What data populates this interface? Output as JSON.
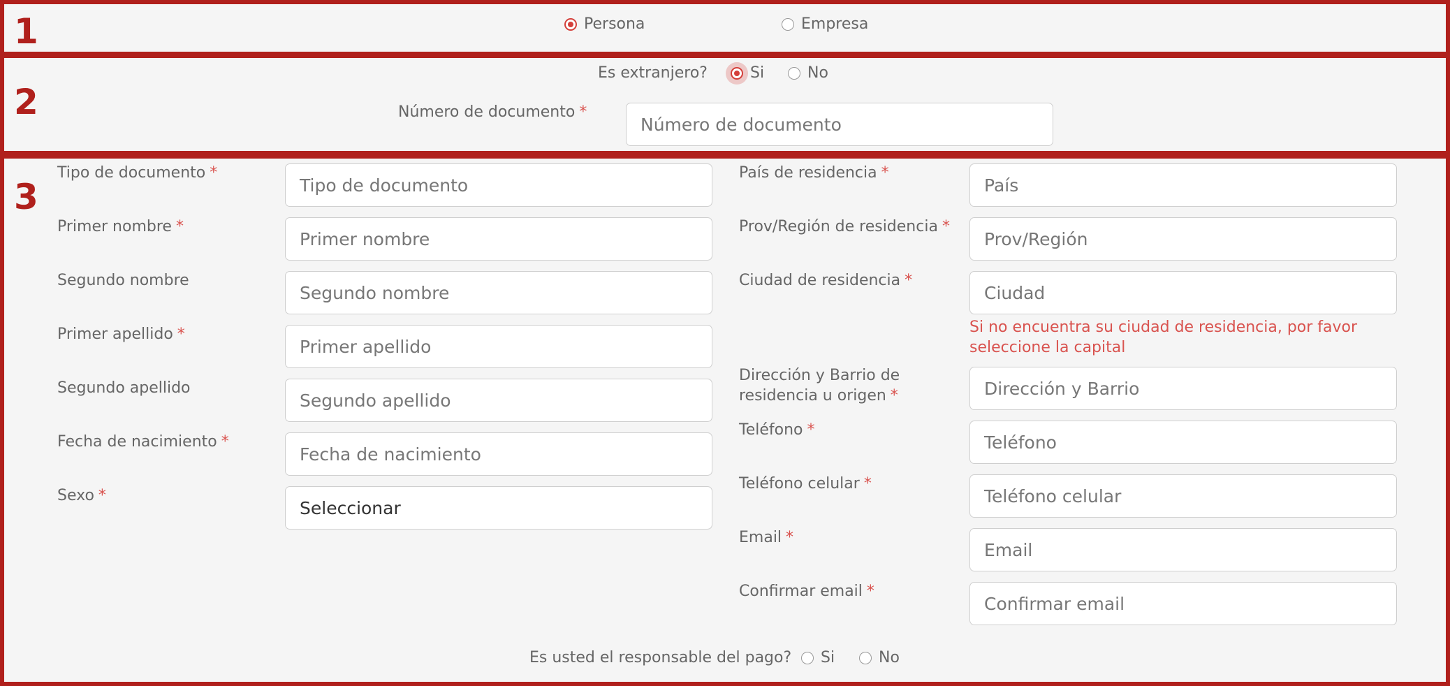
{
  "section_numbers": [
    "1",
    "2",
    "3"
  ],
  "person_type": {
    "options": [
      {
        "label": "Persona",
        "selected": true
      },
      {
        "label": "Empresa",
        "selected": false
      }
    ]
  },
  "foreigner": {
    "question": "Es extranjero?",
    "options": [
      {
        "label": "Si",
        "selected": true
      },
      {
        "label": "No",
        "selected": false
      }
    ]
  },
  "document_number": {
    "label": "Número de documento",
    "required": "*",
    "placeholder": "Número de documento"
  },
  "left_fields": [
    {
      "label": "Tipo de documento",
      "required": "*",
      "placeholder": "Tipo de documento"
    },
    {
      "label": "Primer nombre",
      "required": "*",
      "placeholder": "Primer nombre"
    },
    {
      "label": "Segundo nombre",
      "required": "",
      "placeholder": "Segundo nombre"
    },
    {
      "label": "Primer apellido",
      "required": "*",
      "placeholder": "Primer apellido"
    },
    {
      "label": "Segundo apellido",
      "required": "",
      "placeholder": "Segundo apellido"
    },
    {
      "label": "Fecha de nacimiento",
      "required": "*",
      "placeholder": "Fecha de nacimiento"
    },
    {
      "label": "Sexo",
      "required": "*",
      "value": "Seleccionar"
    }
  ],
  "right_fields": [
    {
      "label": "País de residencia",
      "required": "*",
      "placeholder": "País"
    },
    {
      "label": "Prov/Región de residencia",
      "required": "*",
      "placeholder": "Prov/Región"
    },
    {
      "label": "Ciudad de residencia",
      "required": "*",
      "placeholder": "Ciudad"
    },
    {
      "label_line1": "Dirección y Barrio de",
      "label_line2": "residencia u origen",
      "required": "*",
      "placeholder": "Dirección y Barrio"
    },
    {
      "label": "Teléfono",
      "required": "*",
      "placeholder": "Teléfono"
    },
    {
      "label": "Teléfono celular",
      "required": "*",
      "placeholder": "Teléfono celular"
    },
    {
      "label": "Email",
      "required": "*",
      "placeholder": "Email"
    },
    {
      "label": "Confirmar email",
      "required": "*",
      "placeholder": "Confirmar email"
    }
  ],
  "city_hint": {
    "line1": "Si no encuentra su ciudad de residencia, por favor",
    "line2": "seleccione la capital"
  },
  "payer": {
    "question": "Es usted el responsable del pago?",
    "options": [
      {
        "label": "Si",
        "selected": false
      },
      {
        "label": "No",
        "selected": false
      }
    ]
  },
  "colors": {
    "accent": "#b0201c",
    "required": "#d9534f",
    "radio_selected": "#d43f3a"
  }
}
